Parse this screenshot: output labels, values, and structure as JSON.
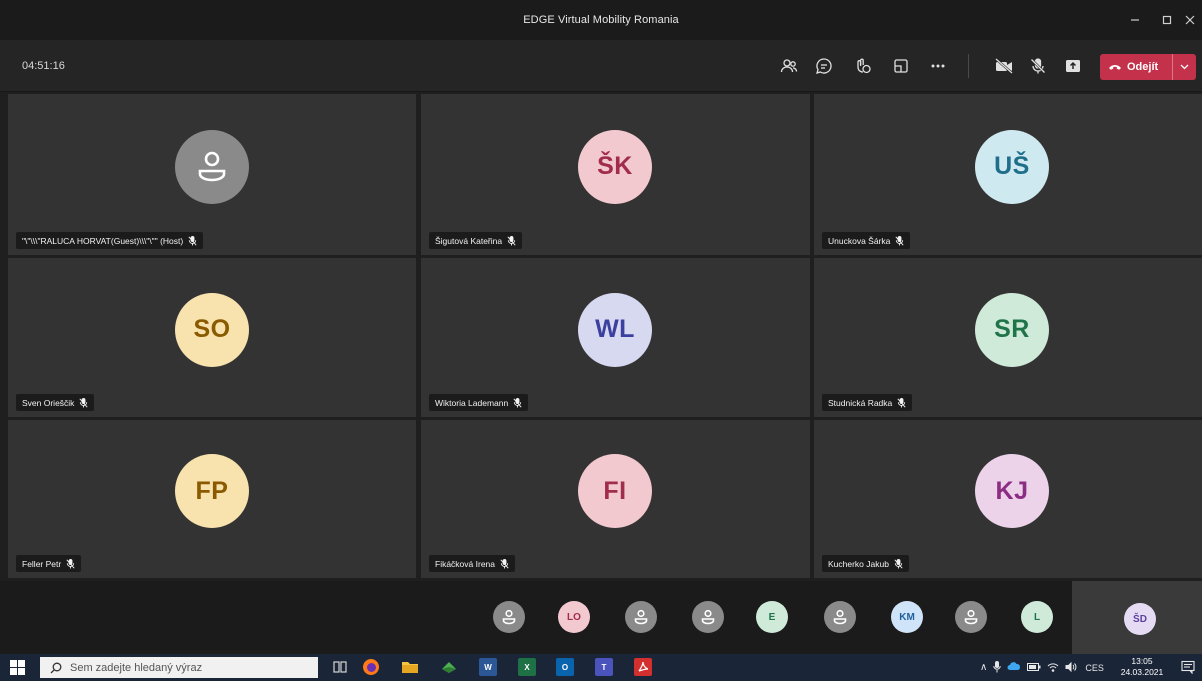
{
  "window": {
    "title": "EDGE Virtual Mobility Romania"
  },
  "toolbar": {
    "timer": "04:51:16",
    "leave_label": "Odejít",
    "icons": [
      "people-icon",
      "chat-icon",
      "reactions-icon",
      "rooms-icon",
      "more-icon",
      "camera-off-icon",
      "mic-off-icon",
      "share-icon"
    ]
  },
  "tiles": [
    {
      "name": "\"\\\"\\\\\\\"RALUCA HORVAT(Guest)\\\\\\\"\\\"\" (Host)",
      "initials": "",
      "bg": "#8a8a8a",
      "fg": "#ffffff",
      "generic": true
    },
    {
      "name": "Šigutová Kateřina",
      "initials": "ŠK",
      "bg": "#f3c9d0",
      "fg": "#a12d4c",
      "generic": false
    },
    {
      "name": "Unuckova Šárka",
      "initials": "UŠ",
      "bg": "#cfe9f1",
      "fg": "#1f6f8b",
      "generic": false
    },
    {
      "name": "Sven Orieščik",
      "initials": "SO",
      "bg": "#f8e2ad",
      "fg": "#8a5a00",
      "generic": false
    },
    {
      "name": "Wiktoria Lademann",
      "initials": "WL",
      "bg": "#d7d9f1",
      "fg": "#3b3f9e",
      "generic": false
    },
    {
      "name": "Studnická Radka",
      "initials": "SR",
      "bg": "#cfead9",
      "fg": "#20744a",
      "generic": false
    },
    {
      "name": "Feller Petr",
      "initials": "FP",
      "bg": "#f8e2ad",
      "fg": "#8a5a00",
      "generic": false
    },
    {
      "name": "Fikáčková Irena",
      "initials": "FI",
      "bg": "#f3c9d0",
      "fg": "#a12d4c",
      "generic": false
    },
    {
      "name": "Kucherko Jakub",
      "initials": "KJ",
      "bg": "#ecd3ea",
      "fg": "#8a2d83",
      "generic": false
    }
  ],
  "strip": [
    {
      "initials": "",
      "bg": "#8a8a8a",
      "fg": "#ffffff",
      "generic": true
    },
    {
      "initials": "LO",
      "bg": "#f3c9d0",
      "fg": "#a12d4c",
      "generic": false
    },
    {
      "initials": "",
      "bg": "#8a8a8a",
      "fg": "#ffffff",
      "generic": true
    },
    {
      "initials": "",
      "bg": "#8a8a8a",
      "fg": "#ffffff",
      "generic": true
    },
    {
      "initials": "E",
      "bg": "#cfead9",
      "fg": "#20744a",
      "generic": false
    },
    {
      "initials": "",
      "bg": "#8a8a8a",
      "fg": "#ffffff",
      "generic": true
    },
    {
      "initials": "KM",
      "bg": "#cfe4f8",
      "fg": "#1f5f9e",
      "generic": false
    },
    {
      "initials": "",
      "bg": "#8a8a8a",
      "fg": "#ffffff",
      "generic": true
    },
    {
      "initials": "L",
      "bg": "#cfead9",
      "fg": "#20744a",
      "generic": false
    }
  ],
  "self": {
    "initials": "ŠD",
    "bg": "#e5dcf4",
    "fg": "#5b3f9e"
  },
  "taskbar": {
    "search_placeholder": "Sem zadejte hledaný výraz",
    "language": "CES",
    "time": "13:05",
    "date": "24.03.2021"
  },
  "colors": {
    "leave_red": "#c4314b",
    "tile_bg": "#333333",
    "taskbar_bg": "#1a2538"
  }
}
